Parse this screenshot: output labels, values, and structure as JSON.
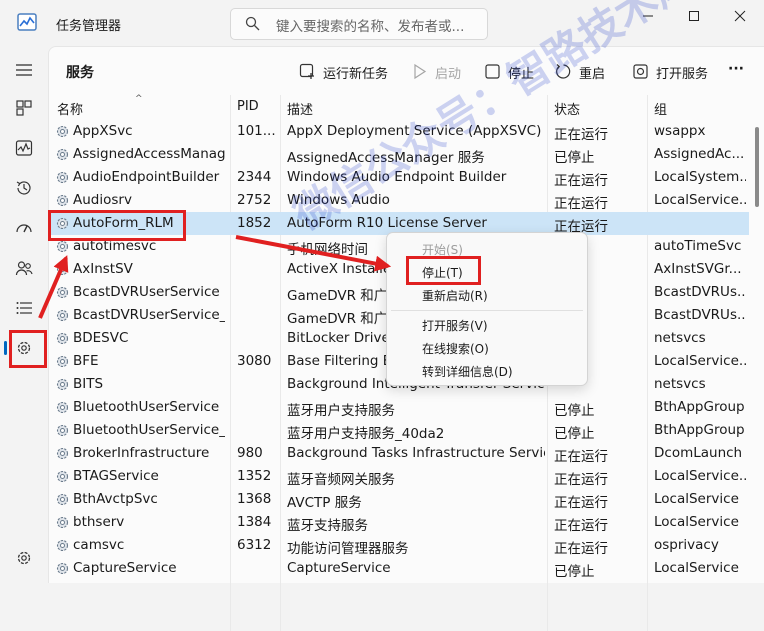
{
  "app": {
    "title": "任务管理器"
  },
  "search": {
    "placeholder": "键入要搜索的名称、发布者或..."
  },
  "toolbar": {
    "page_title": "服务",
    "run_new_task": "运行新任务",
    "start": "启动",
    "stop": "停止",
    "restart": "重启",
    "open_services": "打开服务",
    "more": "···"
  },
  "columns": {
    "name": "名称",
    "pid": "PID",
    "desc": "描述",
    "status": "状态",
    "group": "组"
  },
  "rows": [
    {
      "name": "AppXSvc",
      "pid": "101...",
      "desc": "AppX Deployment Service (AppXSVC)",
      "status": "正在运行",
      "group": "wsappx"
    },
    {
      "name": "AssignedAccessManag...",
      "pid": "",
      "desc": "AssignedAccessManager 服务",
      "status": "已停止",
      "group": "AssignedAc..."
    },
    {
      "name": "AudioEndpointBuilder",
      "pid": "2344",
      "desc": "Windows Audio Endpoint Builder",
      "status": "正在运行",
      "group": "LocalSystem..."
    },
    {
      "name": "Audiosrv",
      "pid": "2752",
      "desc": "Windows Audio",
      "status": "正在运行",
      "group": "LocalService..."
    },
    {
      "name": "AutoForm_RLM",
      "pid": "1852",
      "desc": "AutoForm R10 License Server",
      "status": "正在运行",
      "group": ""
    },
    {
      "name": "autotimesvc",
      "pid": "",
      "desc": "手机网络时间",
      "status": "",
      "group": "autoTimeSvc"
    },
    {
      "name": "AxInstSV",
      "pid": "",
      "desc": "ActiveX Installer",
      "status": "",
      "group": "AxInstSVGr..."
    },
    {
      "name": "BcastDVRUserService",
      "pid": "",
      "desc": "GameDVR 和广播",
      "status": "",
      "group": "BcastDVRUs..."
    },
    {
      "name": "BcastDVRUserService_...",
      "pid": "",
      "desc": "GameDVR 和广播",
      "status": "",
      "group": "BcastDVRUs..."
    },
    {
      "name": "BDESVC",
      "pid": "",
      "desc": "BitLocker Drive E",
      "status": "",
      "group": "netsvcs"
    },
    {
      "name": "BFE",
      "pid": "3080",
      "desc": "Base Filtering En",
      "status": "运行",
      "group": "LocalService..."
    },
    {
      "name": "BITS",
      "pid": "",
      "desc": "Background Intelligent Transfer Service",
      "status": "",
      "group": "netsvcs"
    },
    {
      "name": "BluetoothUserService",
      "pid": "",
      "desc": "蓝牙用户支持服务",
      "status": "已停止",
      "group": "BthAppGroup"
    },
    {
      "name": "BluetoothUserService_...",
      "pid": "",
      "desc": "蓝牙用户支持服务_40da2",
      "status": "已停止",
      "group": "BthAppGroup"
    },
    {
      "name": "BrokerInfrastructure",
      "pid": "980",
      "desc": "Background Tasks Infrastructure Service",
      "status": "正在运行",
      "group": "DcomLaunch"
    },
    {
      "name": "BTAGService",
      "pid": "1352",
      "desc": "蓝牙音频网关服务",
      "status": "正在运行",
      "group": "LocalService..."
    },
    {
      "name": "BthAvctpSvc",
      "pid": "1368",
      "desc": "AVCTP 服务",
      "status": "正在运行",
      "group": "LocalService"
    },
    {
      "name": "bthserv",
      "pid": "1384",
      "desc": "蓝牙支持服务",
      "status": "正在运行",
      "group": "LocalService"
    },
    {
      "name": "camsvc",
      "pid": "6312",
      "desc": "功能访问管理器服务",
      "status": "正在运行",
      "group": "osprivacy"
    },
    {
      "name": "CaptureService",
      "pid": "",
      "desc": "CaptureService",
      "status": "已停止",
      "group": "LocalService"
    }
  ],
  "context_menu": {
    "start": "开始(S)",
    "stop": "停止(T)",
    "restart": "重新启动(R)",
    "open_services": "打开服务(V)",
    "search_online": "在线搜索(O)",
    "goto_details": "转到详细信息(D)"
  },
  "watermark": "微信公众号：智路技术库",
  "colors": {
    "accent": "#0067c0",
    "selected_row": "#cce4f7",
    "highlight": "#e02020"
  }
}
